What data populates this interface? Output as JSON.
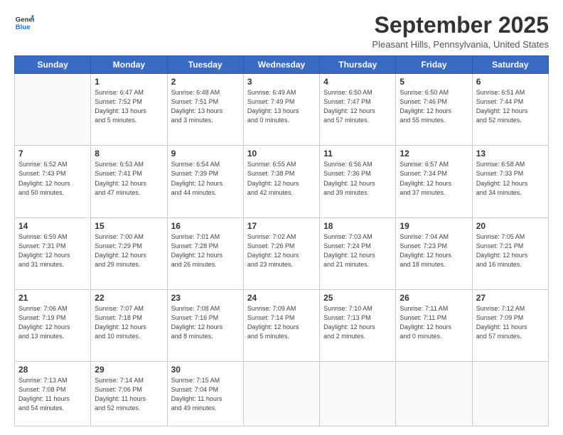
{
  "header": {
    "logo_line1": "General",
    "logo_line2": "Blue",
    "month": "September 2025",
    "location": "Pleasant Hills, Pennsylvania, United States"
  },
  "days_of_week": [
    "Sunday",
    "Monday",
    "Tuesday",
    "Wednesday",
    "Thursday",
    "Friday",
    "Saturday"
  ],
  "weeks": [
    [
      {
        "day": "",
        "info": ""
      },
      {
        "day": "1",
        "info": "Sunrise: 6:47 AM\nSunset: 7:52 PM\nDaylight: 13 hours\nand 5 minutes."
      },
      {
        "day": "2",
        "info": "Sunrise: 6:48 AM\nSunset: 7:51 PM\nDaylight: 13 hours\nand 3 minutes."
      },
      {
        "day": "3",
        "info": "Sunrise: 6:49 AM\nSunset: 7:49 PM\nDaylight: 13 hours\nand 0 minutes."
      },
      {
        "day": "4",
        "info": "Sunrise: 6:50 AM\nSunset: 7:47 PM\nDaylight: 12 hours\nand 57 minutes."
      },
      {
        "day": "5",
        "info": "Sunrise: 6:50 AM\nSunset: 7:46 PM\nDaylight: 12 hours\nand 55 minutes."
      },
      {
        "day": "6",
        "info": "Sunrise: 6:51 AM\nSunset: 7:44 PM\nDaylight: 12 hours\nand 52 minutes."
      }
    ],
    [
      {
        "day": "7",
        "info": "Sunrise: 6:52 AM\nSunset: 7:43 PM\nDaylight: 12 hours\nand 50 minutes."
      },
      {
        "day": "8",
        "info": "Sunrise: 6:53 AM\nSunset: 7:41 PM\nDaylight: 12 hours\nand 47 minutes."
      },
      {
        "day": "9",
        "info": "Sunrise: 6:54 AM\nSunset: 7:39 PM\nDaylight: 12 hours\nand 44 minutes."
      },
      {
        "day": "10",
        "info": "Sunrise: 6:55 AM\nSunset: 7:38 PM\nDaylight: 12 hours\nand 42 minutes."
      },
      {
        "day": "11",
        "info": "Sunrise: 6:56 AM\nSunset: 7:36 PM\nDaylight: 12 hours\nand 39 minutes."
      },
      {
        "day": "12",
        "info": "Sunrise: 6:57 AM\nSunset: 7:34 PM\nDaylight: 12 hours\nand 37 minutes."
      },
      {
        "day": "13",
        "info": "Sunrise: 6:58 AM\nSunset: 7:33 PM\nDaylight: 12 hours\nand 34 minutes."
      }
    ],
    [
      {
        "day": "14",
        "info": "Sunrise: 6:59 AM\nSunset: 7:31 PM\nDaylight: 12 hours\nand 31 minutes."
      },
      {
        "day": "15",
        "info": "Sunrise: 7:00 AM\nSunset: 7:29 PM\nDaylight: 12 hours\nand 29 minutes."
      },
      {
        "day": "16",
        "info": "Sunrise: 7:01 AM\nSunset: 7:28 PM\nDaylight: 12 hours\nand 26 minutes."
      },
      {
        "day": "17",
        "info": "Sunrise: 7:02 AM\nSunset: 7:26 PM\nDaylight: 12 hours\nand 23 minutes."
      },
      {
        "day": "18",
        "info": "Sunrise: 7:03 AM\nSunset: 7:24 PM\nDaylight: 12 hours\nand 21 minutes."
      },
      {
        "day": "19",
        "info": "Sunrise: 7:04 AM\nSunset: 7:23 PM\nDaylight: 12 hours\nand 18 minutes."
      },
      {
        "day": "20",
        "info": "Sunrise: 7:05 AM\nSunset: 7:21 PM\nDaylight: 12 hours\nand 16 minutes."
      }
    ],
    [
      {
        "day": "21",
        "info": "Sunrise: 7:06 AM\nSunset: 7:19 PM\nDaylight: 12 hours\nand 13 minutes."
      },
      {
        "day": "22",
        "info": "Sunrise: 7:07 AM\nSunset: 7:18 PM\nDaylight: 12 hours\nand 10 minutes."
      },
      {
        "day": "23",
        "info": "Sunrise: 7:08 AM\nSunset: 7:16 PM\nDaylight: 12 hours\nand 8 minutes."
      },
      {
        "day": "24",
        "info": "Sunrise: 7:09 AM\nSunset: 7:14 PM\nDaylight: 12 hours\nand 5 minutes."
      },
      {
        "day": "25",
        "info": "Sunrise: 7:10 AM\nSunset: 7:13 PM\nDaylight: 12 hours\nand 2 minutes."
      },
      {
        "day": "26",
        "info": "Sunrise: 7:11 AM\nSunset: 7:11 PM\nDaylight: 12 hours\nand 0 minutes."
      },
      {
        "day": "27",
        "info": "Sunrise: 7:12 AM\nSunset: 7:09 PM\nDaylight: 11 hours\nand 57 minutes."
      }
    ],
    [
      {
        "day": "28",
        "info": "Sunrise: 7:13 AM\nSunset: 7:08 PM\nDaylight: 11 hours\nand 54 minutes."
      },
      {
        "day": "29",
        "info": "Sunrise: 7:14 AM\nSunset: 7:06 PM\nDaylight: 11 hours\nand 52 minutes."
      },
      {
        "day": "30",
        "info": "Sunrise: 7:15 AM\nSunset: 7:04 PM\nDaylight: 11 hours\nand 49 minutes."
      },
      {
        "day": "",
        "info": ""
      },
      {
        "day": "",
        "info": ""
      },
      {
        "day": "",
        "info": ""
      },
      {
        "day": "",
        "info": ""
      }
    ]
  ]
}
